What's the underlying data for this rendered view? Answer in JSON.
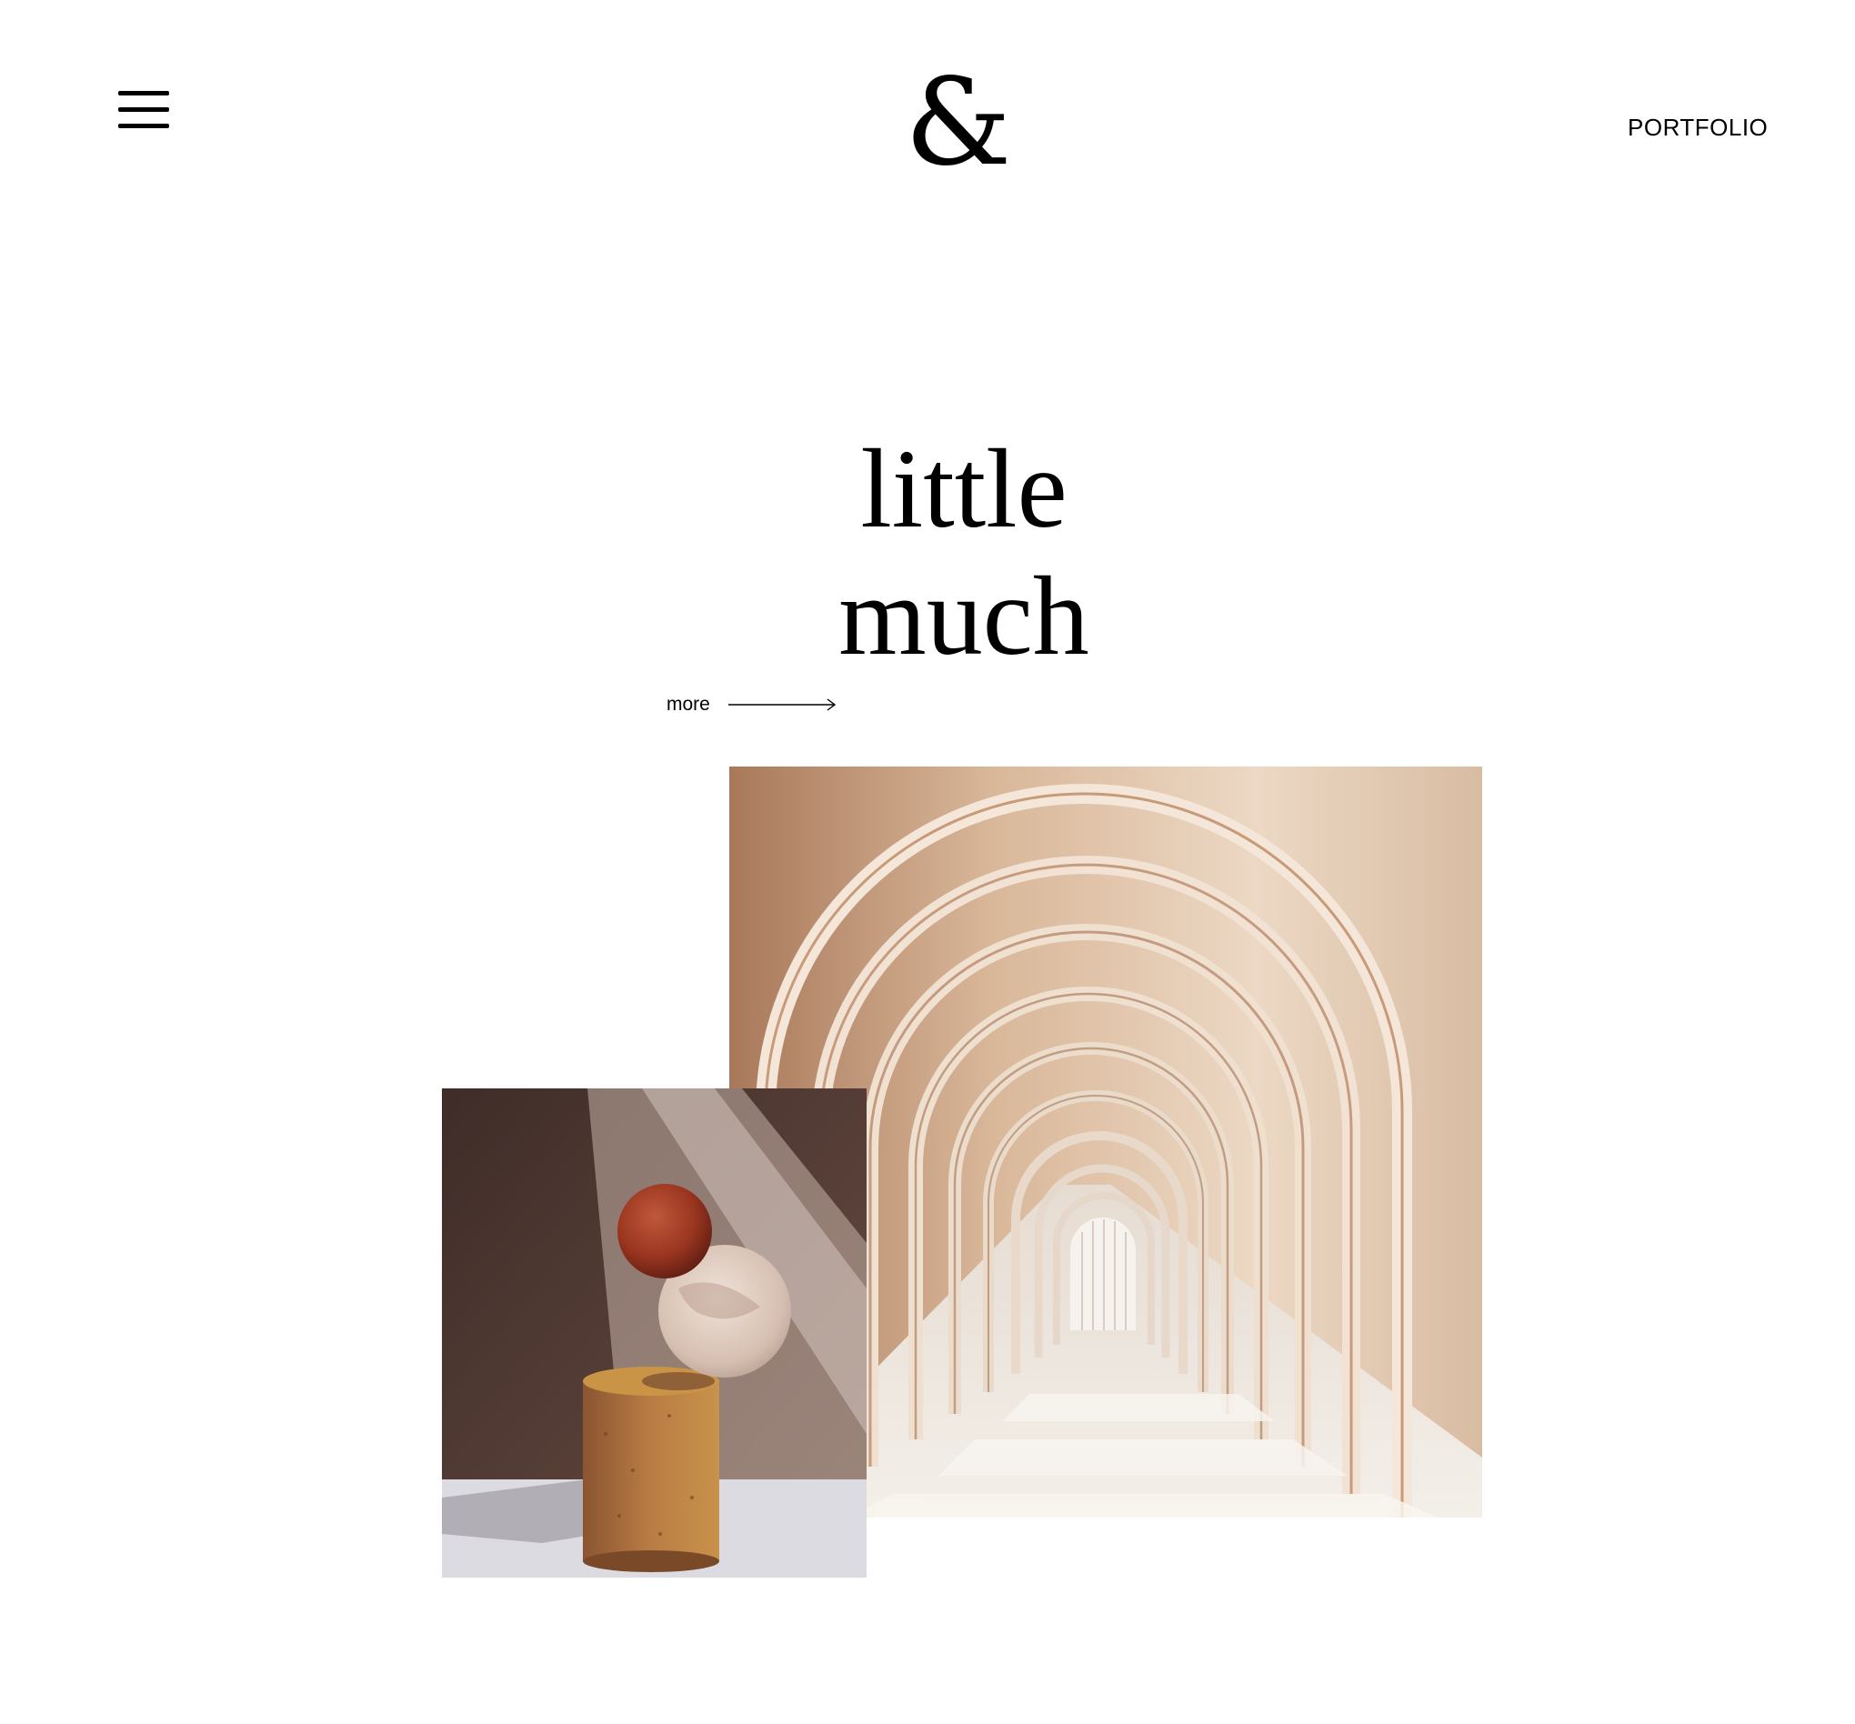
{
  "header": {
    "menu_icon": "hamburger-menu-icon",
    "logo_text": "&",
    "portfolio_label": "PORTFOLIO"
  },
  "hero": {
    "title_line1": "little",
    "title_line2": "much",
    "more_label": "more",
    "more_icon": "long-arrow-right-icon"
  },
  "images": {
    "arches_alt": "arched corridor photo",
    "sculpture_alt": "balanced sculpture photo"
  },
  "colors": {
    "background": "#ffffff",
    "text": "#000000",
    "arch_light": "#efdfcf",
    "arch_shadow": "#a87a5a",
    "sculpture_bg": "#5a4038",
    "sphere_red": "#9c3a22",
    "cylinder_ochre": "#b57a3e"
  }
}
